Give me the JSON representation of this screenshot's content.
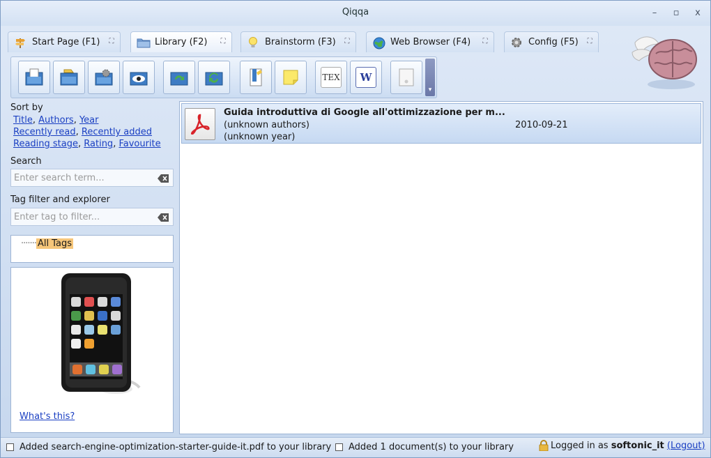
{
  "window": {
    "title": "Qiqqa",
    "minimize_label": "–",
    "maximize_label": "▫",
    "close_label": "x"
  },
  "tabs": [
    {
      "label": "Start Page (F1)",
      "icon": "signpost-icon",
      "active": false
    },
    {
      "label": "Library (F2)",
      "icon": "folder-icon",
      "active": true
    },
    {
      "label": "Brainstorm (F3)",
      "icon": "lightbulb-icon",
      "active": false
    },
    {
      "label": "Web Browser (F4)",
      "icon": "globe-icon",
      "active": false
    },
    {
      "label": "Config (F5)",
      "icon": "gear-icon",
      "active": false
    }
  ],
  "toolbar": {
    "buttons": [
      {
        "name": "add-document-icon"
      },
      {
        "name": "add-folder-icon"
      },
      {
        "name": "import-settings-icon"
      },
      {
        "name": "view-icon"
      },
      {
        "name": "sync-icon"
      },
      {
        "name": "sync-cloud-icon"
      },
      {
        "name": "document-bookmark-icon"
      },
      {
        "name": "sticky-note-icon"
      },
      {
        "name": "tex-icon",
        "text": "TEX"
      },
      {
        "name": "word-icon",
        "text": "W"
      },
      {
        "name": "blank-document-icon"
      }
    ]
  },
  "sidebar": {
    "sort_heading": "Sort by",
    "sort_links": {
      "title": "Title",
      "authors": "Authors",
      "year": "Year",
      "recently_read": "Recently read",
      "recently_added": "Recently added",
      "reading_stage": "Reading stage",
      "rating": "Rating",
      "favourite": "Favourite"
    },
    "search_heading": "Search",
    "search_placeholder": "Enter search term...",
    "tag_heading": "Tag filter and explorer",
    "tag_placeholder": "Enter tag to filter...",
    "tag_root_prefix": "·······",
    "tag_root": "All Tags",
    "ad_link": "What's this?"
  },
  "documents": [
    {
      "title": "Guida introduttiva di Google all'ottimizzazione per m...",
      "authors": "(unknown authors)",
      "year": "(unknown year)",
      "date": "2010-09-21",
      "icon": "pdf-icon"
    }
  ],
  "status": {
    "message1": "Added search-engine-optimization-starter-guide-it.pdf to your library",
    "message2": "Added 1 document(s) to your library",
    "logged_prefix": "Logged in as",
    "username": "softonic_it",
    "logout": "(Logout)"
  },
  "colors": {
    "link": "#1a3fc2",
    "selected_row": "#c6d9f2",
    "tag_highlight": "#f6c67a",
    "pdf_red": "#d8232a"
  }
}
